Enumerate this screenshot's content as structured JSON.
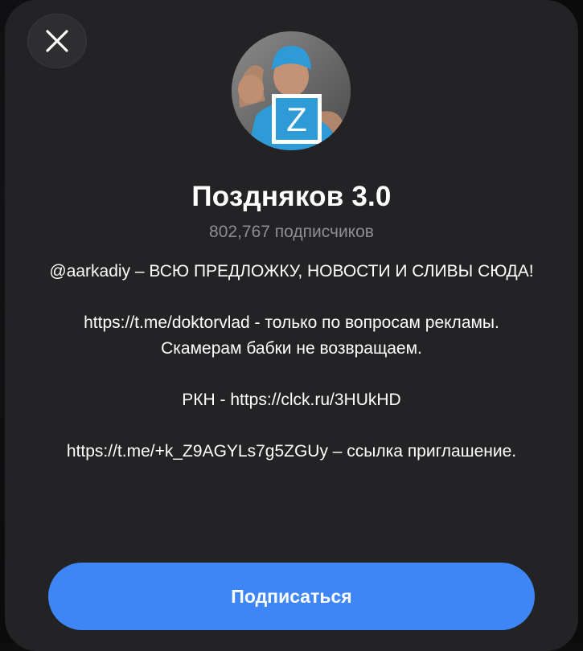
{
  "dialog": {
    "close_icon": "close-icon",
    "avatar_badge_letter": "Z"
  },
  "channel": {
    "title": "Поздняков 3.0",
    "subscribers": "802,767 подписчиков",
    "description": [
      "@aarkadiy – ВСЮ ПРЕДЛОЖКУ, НОВОСТИ И СЛИВЫ СЮДА!",
      "https://t.me/doktorvlad - только по вопросам рекламы. Скамерам бабки не возвращаем.",
      "РКН - https://clck.ru/3HUkHD",
      "https://t.me/+k_Z9AGYLs7g5ZGUy – ссылка приглашение."
    ]
  },
  "actions": {
    "subscribe_label": "Подписаться"
  },
  "colors": {
    "sheet_background": "#232325",
    "accent": "#3e86f5",
    "secondary_text": "#8e8e93"
  }
}
